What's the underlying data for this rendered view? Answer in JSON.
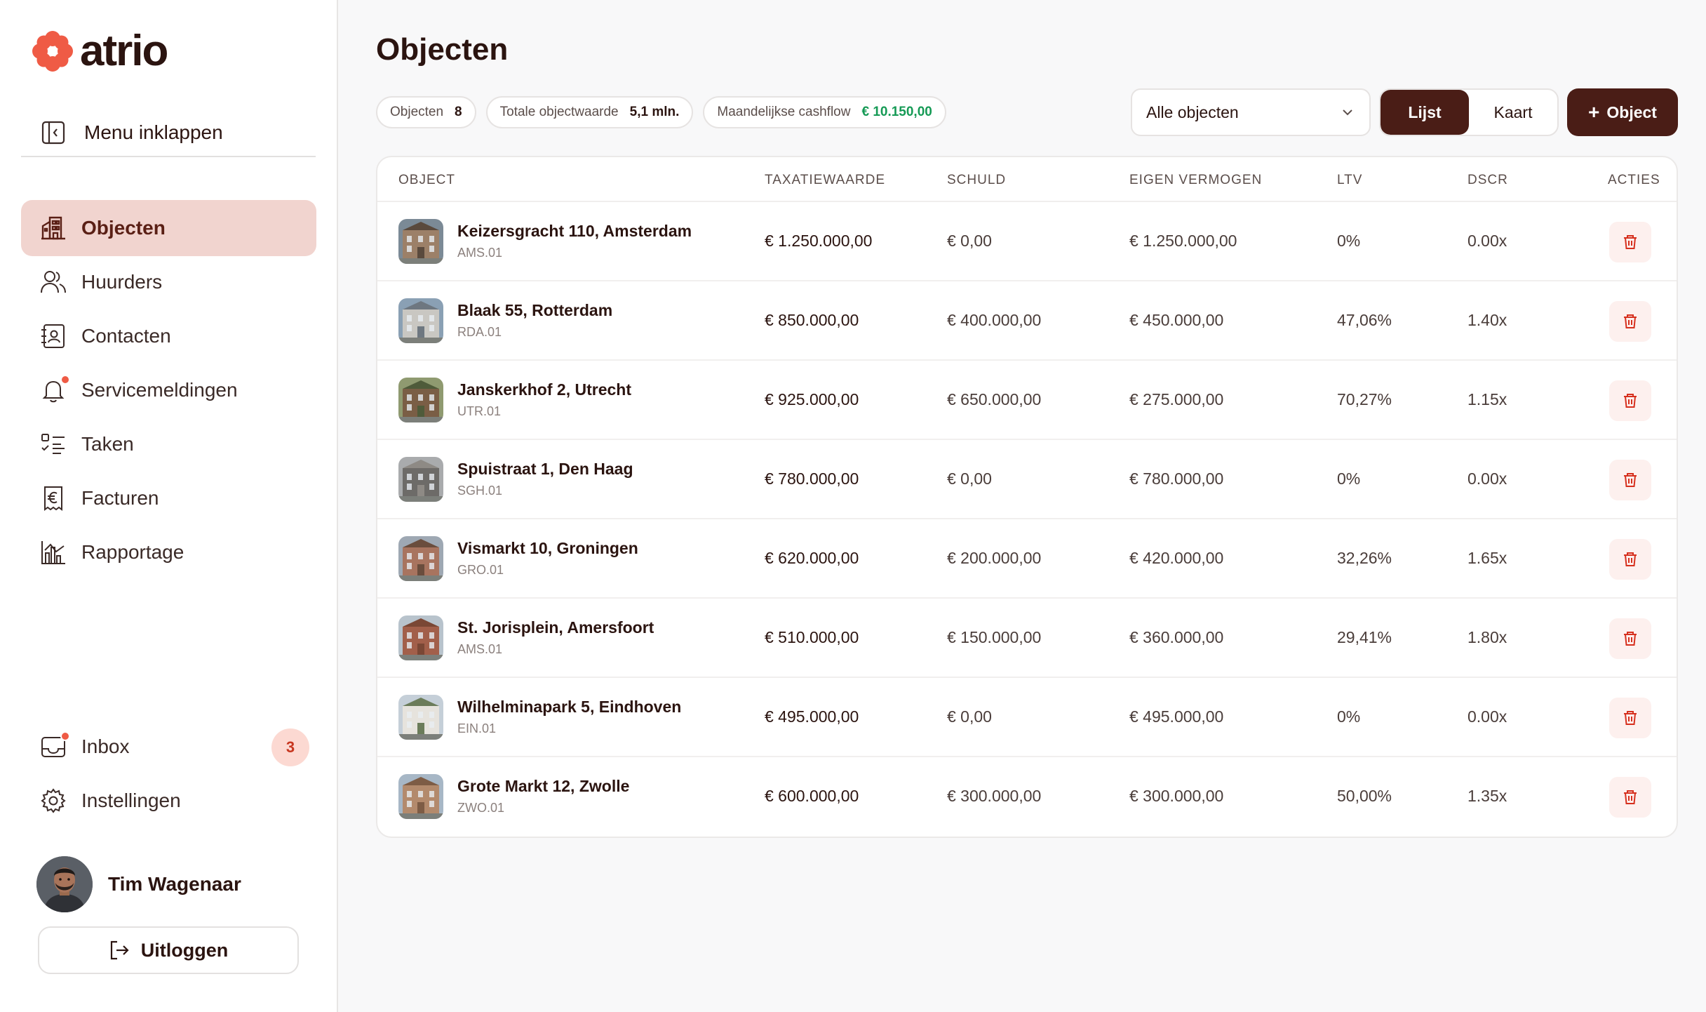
{
  "brand": {
    "name": "atrio",
    "accent": "#ef5b45",
    "dark": "#4a1d16"
  },
  "sidebar": {
    "collapse_label": "Menu inklappen",
    "items": [
      {
        "label": "Objecten",
        "icon": "building-icon",
        "active": true
      },
      {
        "label": "Huurders",
        "icon": "users-icon"
      },
      {
        "label": "Contacten",
        "icon": "contact-book-icon"
      },
      {
        "label": "Servicemeldingen",
        "icon": "bell-icon",
        "dot": true
      },
      {
        "label": "Taken",
        "icon": "checklist-icon"
      },
      {
        "label": "Facturen",
        "icon": "euro-receipt-icon"
      },
      {
        "label": "Rapportage",
        "icon": "bar-chart-icon"
      }
    ],
    "bottom_items": [
      {
        "label": "Inbox",
        "icon": "inbox-icon",
        "badge": "3"
      },
      {
        "label": "Instellingen",
        "icon": "gear-icon"
      }
    ],
    "user": {
      "name": "Tim Wagenaar"
    },
    "logout_label": "Uitloggen"
  },
  "main": {
    "title": "Objecten",
    "chips": [
      {
        "label": "Objecten",
        "value": "8"
      },
      {
        "label": "Totale objectwaarde",
        "value": "5,1 mln."
      },
      {
        "label": "Maandelijkse cashflow",
        "value": "€ 10.150,00"
      }
    ],
    "filter": {
      "value": "Alle objecten"
    },
    "view_toggle": {
      "list": "Lijst",
      "map": "Kaart",
      "active": "list"
    },
    "add_button": "Object",
    "table": {
      "headers": {
        "object": "OBJECT",
        "valuation": "TAXATIEWAARDE",
        "debt": "SCHULD",
        "equity": "EIGEN VERMOGEN",
        "ltv": "LTV",
        "dscr": "DSCR",
        "actions": "ACTIES"
      },
      "rows": [
        {
          "name": "Keizersgracht 110, Amsterdam",
          "code": "AMS.01",
          "valuation": "€ 1.250.000,00",
          "debt": "€ 0,00",
          "equity": "€ 1.250.000,00",
          "ltv": "0%",
          "dscr": "0.00x"
        },
        {
          "name": "Blaak 55, Rotterdam",
          "code": "RDA.01",
          "valuation": "€ 850.000,00",
          "debt": "€ 400.000,00",
          "equity": "€ 450.000,00",
          "ltv": "47,06%",
          "dscr": "1.40x"
        },
        {
          "name": "Janskerkhof 2, Utrecht",
          "code": "UTR.01",
          "valuation": "€ 925.000,00",
          "debt": "€ 650.000,00",
          "equity": "€ 275.000,00",
          "ltv": "70,27%",
          "dscr": "1.15x"
        },
        {
          "name": "Spuistraat 1, Den Haag",
          "code": "SGH.01",
          "valuation": "€ 780.000,00",
          "debt": "€ 0,00",
          "equity": "€ 780.000,00",
          "ltv": "0%",
          "dscr": "0.00x"
        },
        {
          "name": "Vismarkt 10, Groningen",
          "code": "GRO.01",
          "valuation": "€ 620.000,00",
          "debt": "€ 200.000,00",
          "equity": "€ 420.000,00",
          "ltv": "32,26%",
          "dscr": "1.65x"
        },
        {
          "name": "St. Jorisplein, Amersfoort",
          "code": "AMS.01",
          "valuation": "€ 510.000,00",
          "debt": "€ 150.000,00",
          "equity": "€ 360.000,00",
          "ltv": "29,41%",
          "dscr": "1.80x"
        },
        {
          "name": "Wilhelminapark 5, Eindhoven",
          "code": "EIN.01",
          "valuation": "€ 495.000,00",
          "debt": "€ 0,00",
          "equity": "€ 495.000,00",
          "ltv": "0%",
          "dscr": "0.00x"
        },
        {
          "name": "Grote Markt 12, Zwolle",
          "code": "ZWO.01",
          "valuation": "€ 600.000,00",
          "debt": "€ 300.000,00",
          "equity": "€ 300.000,00",
          "ltv": "50,00%",
          "dscr": "1.35x"
        }
      ]
    }
  }
}
